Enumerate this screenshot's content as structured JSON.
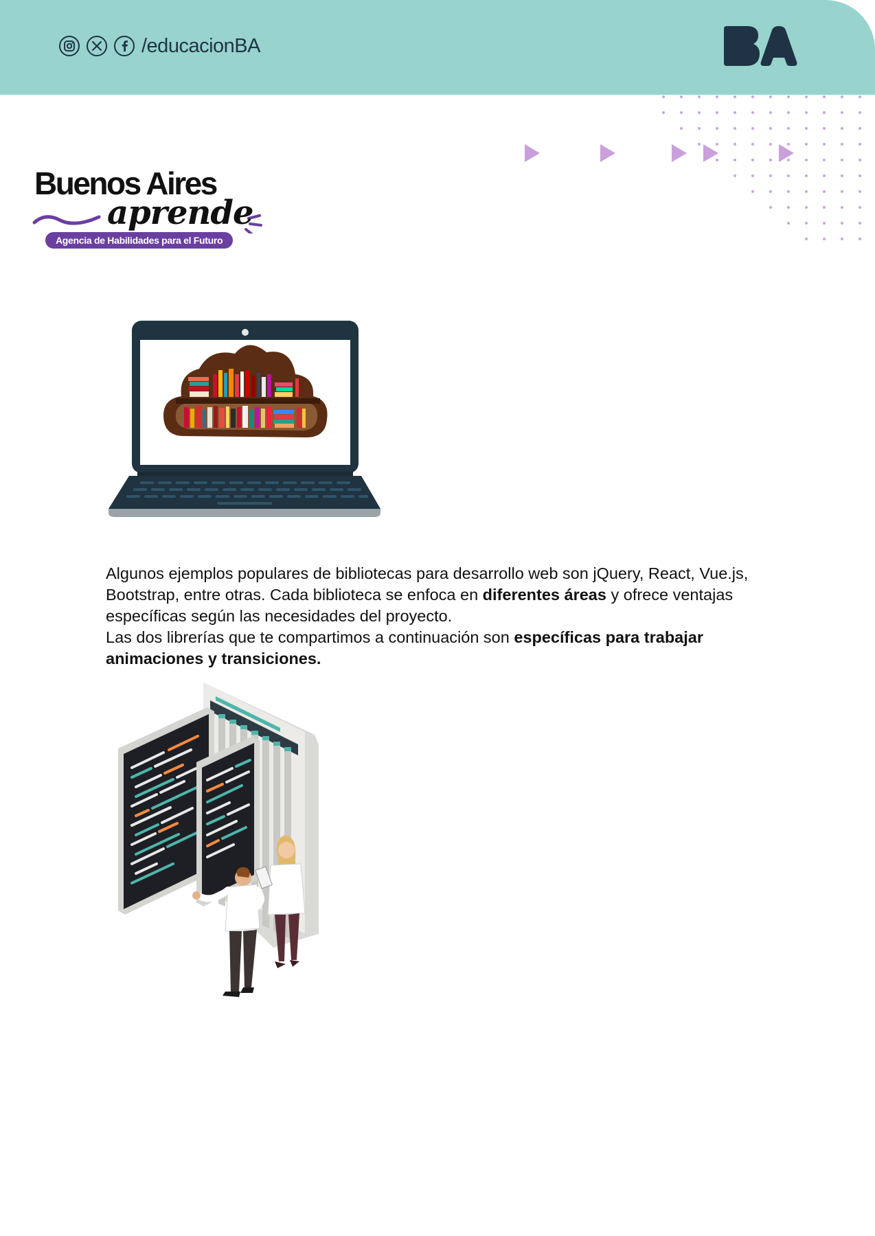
{
  "header": {
    "social_icons": [
      "instagram-icon",
      "x-icon",
      "facebook-icon"
    ],
    "handle": "/educacionBA",
    "logo_text": "BA",
    "background_color": "#98d3cd",
    "ink_color": "#1f3345"
  },
  "brand": {
    "name": "Buenos Aires",
    "script": "aprende",
    "tagline": "Agencia de Habilidades para el Futuro",
    "accent_color": "#6b3fa0"
  },
  "decorations": {
    "arrow_color": "#c9a0dc",
    "dot_color": "#c7a6dc"
  },
  "content": {
    "paragraph1": {
      "part1": "Algunos ejemplos populares de bibliotecas para desarrollo web son jQuery, React, Vue.js, Bootstrap, entre otras. Cada biblioteca se enfoca en ",
      "bold1": "diferentes áreas",
      "part2": " y ofrece ventajas específicas según las necesidades del proyecto."
    },
    "paragraph2": {
      "part1": "Las dos librerías que te compartimos a continuación son ",
      "bold1": "específicas para trabajar animaciones y transiciones."
    }
  },
  "illustrations": {
    "laptop": "laptop-books-illustration",
    "servers": "code-screens-people-illustration"
  }
}
